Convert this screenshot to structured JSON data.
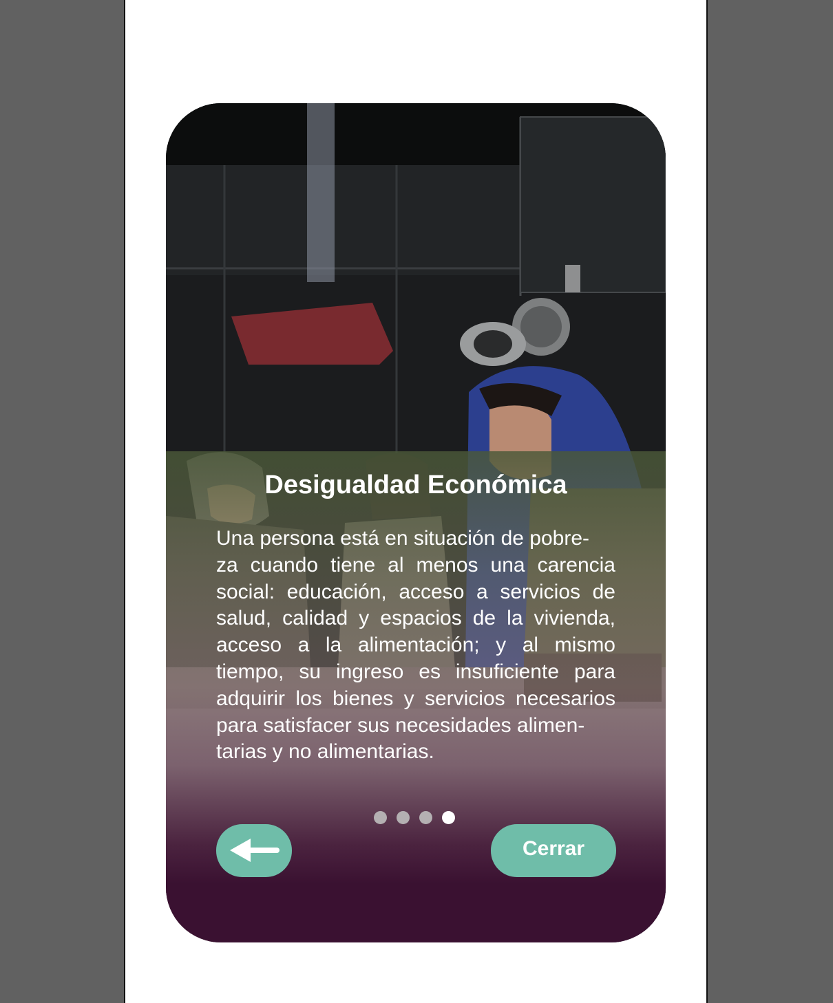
{
  "slide": {
    "title": "Desigualdad Económica",
    "body": "Una persona está en situación de pobre-\nza cuando tiene al menos una carencia social: educación, acceso a servicios de salud, calidad y espacios de la vivienda, acceso a la alimentación; y al mismo tiempo, su ingreso es insuficiente para adquirir los bienes y servicios necesarios para satisfacer sus necesidades alimen-\ntarias y no alimentarias."
  },
  "pagination": {
    "total": 4,
    "current": 4
  },
  "buttons": {
    "back_icon": "arrow-left-icon",
    "close_label": "Cerrar"
  },
  "colors": {
    "accent": "#6fbda9",
    "card_bottom": "#3a1131"
  }
}
